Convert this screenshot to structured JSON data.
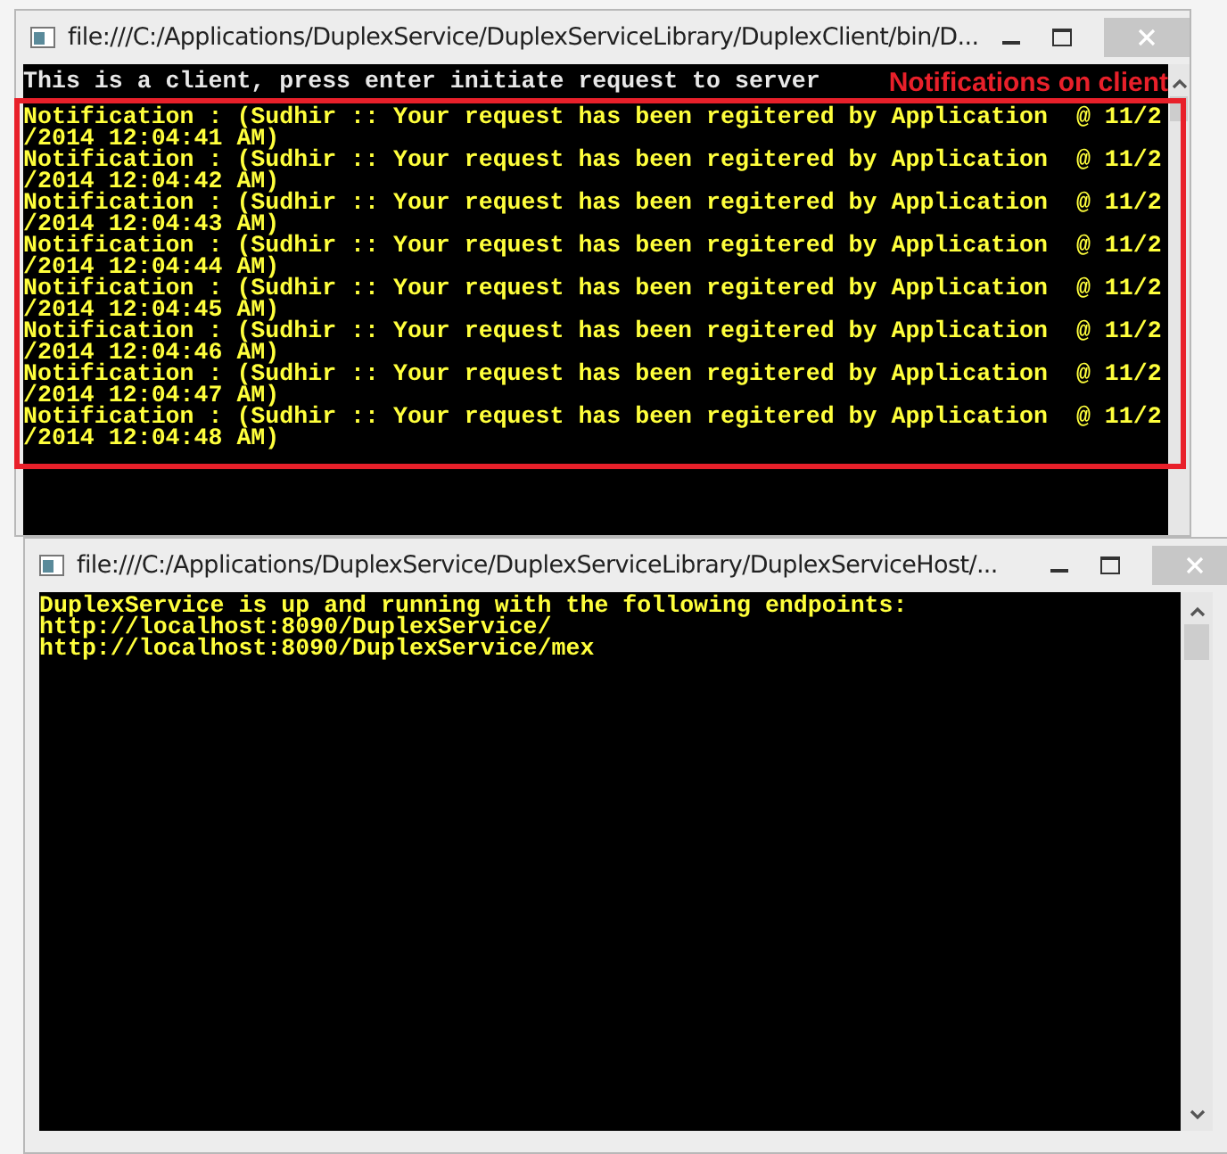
{
  "client_window": {
    "title": "file:///C:/Applications/DuplexService/DuplexServiceLibrary/DuplexClient/bin/D...",
    "prompt_line": "This is a client, press enter initiate request to server",
    "annotation": "Notifications on client",
    "notification_lines": [
      "Notification : (Sudhir :: Your request has been regitered by Application  @ 11/2",
      "/2014 12:04:41 AM)",
      "Notification : (Sudhir :: Your request has been regitered by Application  @ 11/2",
      "/2014 12:04:42 AM)",
      "Notification : (Sudhir :: Your request has been regitered by Application  @ 11/2",
      "/2014 12:04:43 AM)",
      "Notification : (Sudhir :: Your request has been regitered by Application  @ 11/2",
      "/2014 12:04:44 AM)",
      "Notification : (Sudhir :: Your request has been regitered by Application  @ 11/2",
      "/2014 12:04:45 AM)",
      "Notification : (Sudhir :: Your request has been regitered by Application  @ 11/2",
      "/2014 12:04:46 AM)",
      "Notification : (Sudhir :: Your request has been regitered by Application  @ 11/2",
      "/2014 12:04:47 AM)",
      "Notification : (Sudhir :: Your request has been regitered by Application  @ 11/2",
      "/2014 12:04:48 AM)"
    ]
  },
  "host_window": {
    "title": "file:///C:/Applications/DuplexService/DuplexServiceLibrary/DuplexServiceHost/...",
    "console_lines": [
      "DuplexService is up and running with the following endpoints:",
      "http://localhost:8090/DuplexService/",
      "http://localhost:8090/DuplexService/mex"
    ]
  }
}
